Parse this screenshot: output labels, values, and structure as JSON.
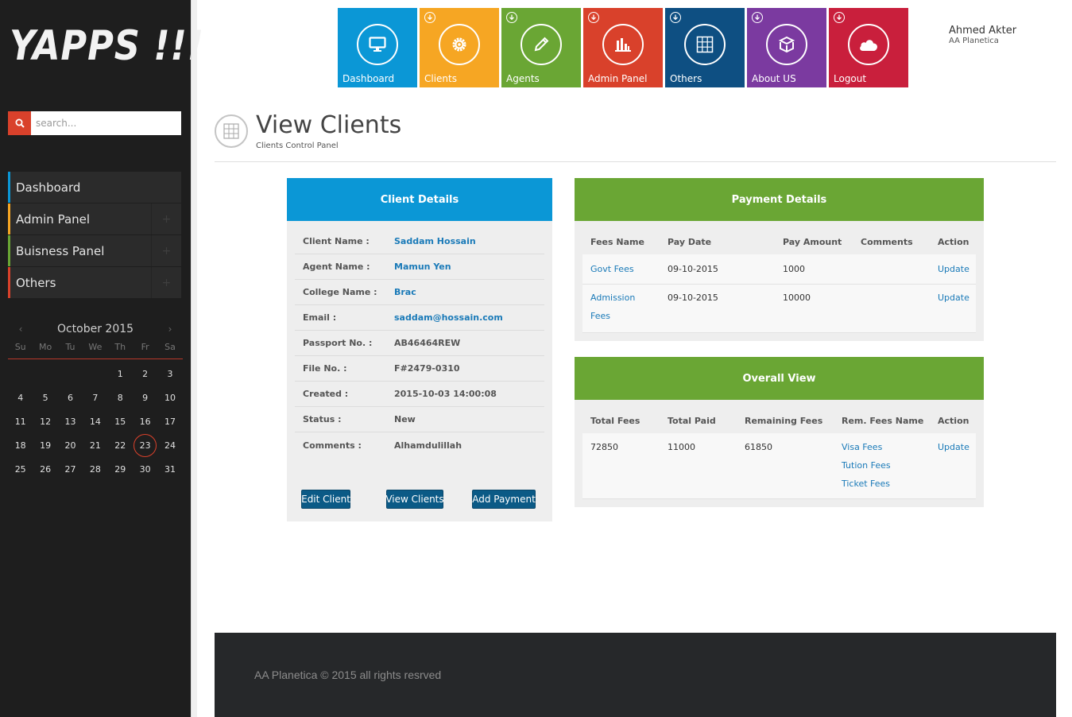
{
  "logo": "YAPPS !!!",
  "search": {
    "placeholder": "search..."
  },
  "sidebar": {
    "items": [
      {
        "label": "Dashboard",
        "color": "#0b97d6"
      },
      {
        "label": "Admin Panel",
        "color": "#f6a623"
      },
      {
        "label": "Buisness Panel",
        "color": "#6aa634"
      },
      {
        "label": "Others",
        "color": "#d9412b"
      }
    ]
  },
  "calendar": {
    "month_label": "October 2015",
    "weekdays": [
      "Su",
      "Mo",
      "Tu",
      "We",
      "Th",
      "Fr",
      "Sa"
    ],
    "today": 23
  },
  "tiles": [
    {
      "label": "Dashboard",
      "color": "#0b97d6",
      "icon": "monitor-icon"
    },
    {
      "label": "Clients",
      "color": "#f6a623",
      "icon": "gear-icon"
    },
    {
      "label": "Agents",
      "color": "#6aa634",
      "icon": "pencil-icon"
    },
    {
      "label": "Admin Panel",
      "color": "#d9412b",
      "icon": "bar-chart-icon"
    },
    {
      "label": "Others",
      "color": "#0e4f82",
      "icon": "grid-icon"
    },
    {
      "label": "About US",
      "color": "#7b3aa0",
      "icon": "box-icon"
    },
    {
      "label": "Logout",
      "color": "#c91f3c",
      "icon": "cloud-icon"
    }
  ],
  "user": {
    "name": "Ahmed Akter",
    "org": "AA Planetica"
  },
  "page": {
    "title": "View Clients",
    "subtitle": "Clients Control Panel"
  },
  "client_details": {
    "title": "Client Details",
    "rows": [
      {
        "key": "Client Name :",
        "value": "Saddam Hossain",
        "link": true
      },
      {
        "key": "Agent Name :",
        "value": "Mamun Yen",
        "link": true
      },
      {
        "key": "College Name :",
        "value": "Brac",
        "link": true
      },
      {
        "key": "Email :",
        "value": "saddam@hossain.com",
        "link": true
      },
      {
        "key": "Passport No. :",
        "value": "AB46464REW",
        "link": false
      },
      {
        "key": "File No. :",
        "value": "F#2479-0310",
        "link": false
      },
      {
        "key": "Created :",
        "value": "2015-10-03 14:00:08",
        "link": false
      },
      {
        "key": "Status :",
        "value": "New",
        "link": false
      },
      {
        "key": "Comments :",
        "value": "Alhamdulillah",
        "link": false
      }
    ],
    "buttons": {
      "edit": "Edit Client",
      "view": "View Clients",
      "add_payment": "Add Payment"
    }
  },
  "payment_details": {
    "title": "Payment Details",
    "headers": [
      "Fees Name",
      "Pay Date",
      "Pay Amount",
      "Comments",
      "Action"
    ],
    "rows": [
      {
        "fees_name": "Govt Fees",
        "pay_date": "09-10-2015",
        "pay_amount": "1000",
        "comments": "",
        "action": "Update"
      },
      {
        "fees_name": "Admission Fees",
        "pay_date": "09-10-2015",
        "pay_amount": "10000",
        "comments": "",
        "action": "Update"
      }
    ]
  },
  "overall_view": {
    "title": "Overall View",
    "headers": [
      "Total Fees",
      "Total Paid",
      "Remaining Fees",
      "Rem. Fees Name",
      "Action"
    ],
    "row": {
      "total_fees": "72850",
      "total_paid": "11000",
      "remaining_fees": "61850",
      "rem_fees_names": [
        "Visa Fees",
        "Tution Fees",
        "Ticket Fees"
      ],
      "action": "Update"
    }
  },
  "footer": {
    "text": "AA Planetica © 2015 all rights resrved"
  }
}
